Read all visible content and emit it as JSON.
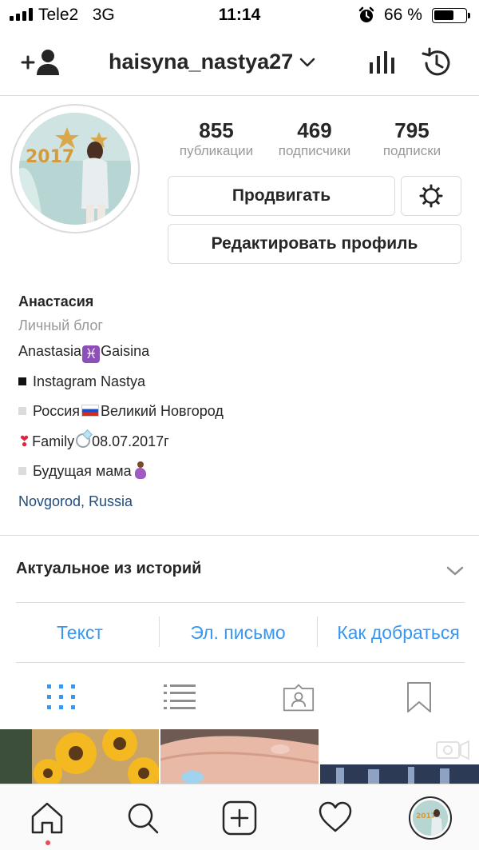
{
  "status_bar": {
    "carrier": "Tele2",
    "network": "3G",
    "time": "11:14",
    "battery_percent_label": "66 %",
    "battery_level": 0.66,
    "icons": [
      "signal-icon",
      "alarm-icon",
      "battery-icon"
    ]
  },
  "header": {
    "username": "haisyna_nastya27",
    "icons": [
      "add-user-icon",
      "chevron-down-icon",
      "insights-icon",
      "archive-history-icon"
    ]
  },
  "profile": {
    "stats": [
      {
        "value": "855",
        "label": "публикации"
      },
      {
        "value": "469",
        "label": "подписчики"
      },
      {
        "value": "795",
        "label": "подписки"
      }
    ],
    "promote_label": "Продвигать",
    "edit_label": "Редактировать профиль"
  },
  "bio": {
    "name": "Анастасия",
    "category": "Личный блог",
    "line1_a": "Anastasia",
    "line1_b": "Gaisina",
    "line2": "Instagram Nastya",
    "line3_a": "Россия",
    "line3_b": "Великий Новгород",
    "line4_a": "Family",
    "line4_b": "08.07.2017г",
    "line5": "Будущая мама",
    "location": "Novgorod, Russia"
  },
  "highlights": {
    "title": "Актуальное из историй"
  },
  "contact": {
    "text": "Текст",
    "email": "Эл. письмо",
    "directions": "Как добраться"
  },
  "colors": {
    "accent": "#3897f0",
    "location": "#1f4c7c",
    "muted": "#999999",
    "notification": "#ed4956"
  }
}
